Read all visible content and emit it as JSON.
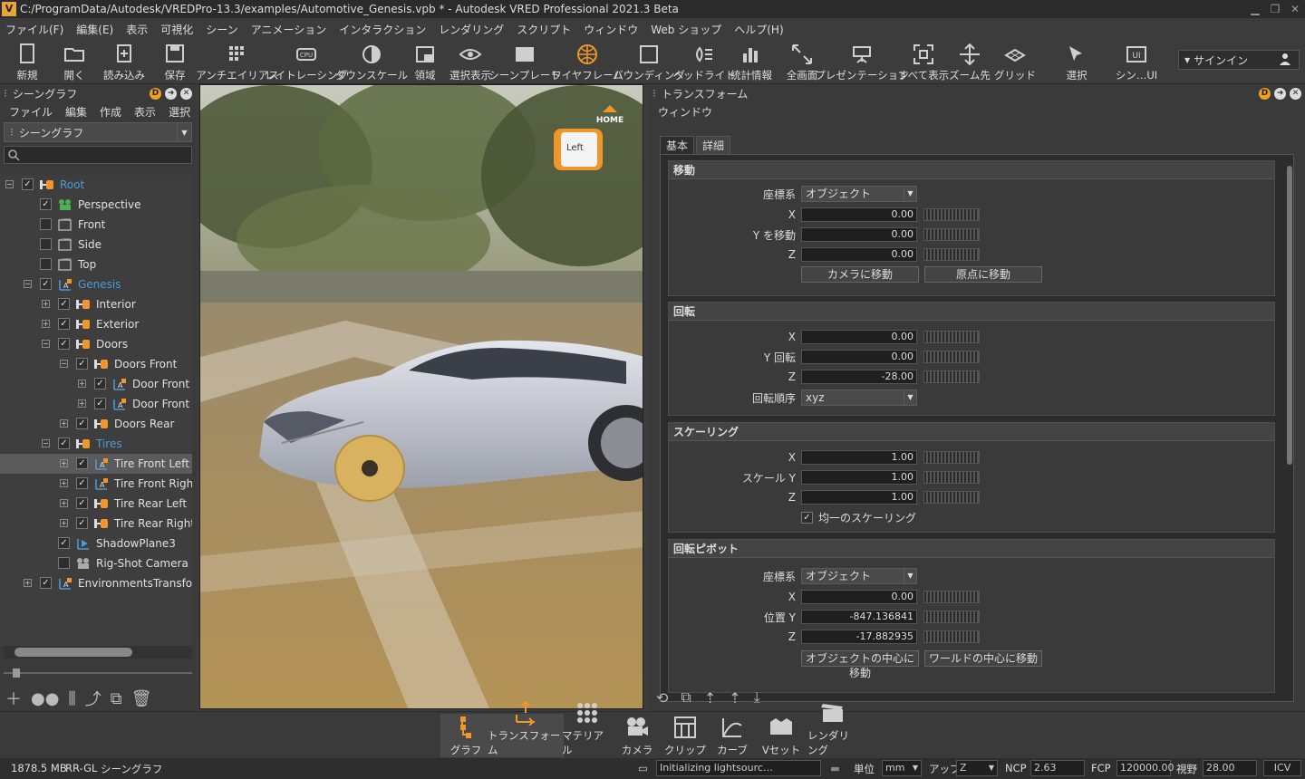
{
  "window": {
    "title": "C:/ProgramData/Autodesk/VREDPro-13.3/examples/Automotive_Genesis.vpb * - Autodesk VRED Professional 2021.3 Beta"
  },
  "menu": [
    "ファイル(F)",
    "編集(E)",
    "表示",
    "可視化",
    "シーン",
    "アニメーション",
    "インタラクション",
    "レンダリング",
    "スクリプト",
    "ウィンドウ",
    "Web ショップ",
    "ヘルプ(H)"
  ],
  "toolbar": [
    {
      "label": "新規",
      "icon": "new-file-icon"
    },
    {
      "label": "開く",
      "icon": "open-folder-icon"
    },
    {
      "label": "読み込み",
      "icon": "import-icon"
    },
    {
      "label": "保存",
      "icon": "save-icon"
    },
    {
      "label": "アンチエイリアス",
      "icon": "antialias-icon"
    },
    {
      "label": "レイトレーシング",
      "icon": "cpu-icon"
    },
    {
      "label": "ダウンスケール",
      "icon": "downscale-icon"
    },
    {
      "label": "領域",
      "icon": "region-icon"
    },
    {
      "label": "選択表示",
      "icon": "eye-icon"
    },
    {
      "label": "シーンプレート",
      "icon": "sceneplate-icon"
    },
    {
      "label": "ワイヤフレーム",
      "icon": "wireframe-globe-icon"
    },
    {
      "label": "バウンディング",
      "icon": "bounding-box-icon"
    },
    {
      "label": "ヘッドライト",
      "icon": "headlight-icon"
    },
    {
      "label": "統計情報",
      "icon": "statistics-icon"
    },
    {
      "label": "全画面",
      "icon": "fullscreen-icon"
    },
    {
      "label": "プレゼンテーション",
      "icon": "presentation-icon"
    },
    {
      "label": "すべて表示",
      "icon": "fit-all-icon"
    },
    {
      "label": "ズーム先",
      "icon": "zoom-to-icon"
    },
    {
      "label": "グリッド",
      "icon": "grid-icon"
    },
    {
      "label": "選択",
      "icon": "select-icon"
    },
    {
      "label": "シン…UI",
      "icon": "ui-icon"
    }
  ],
  "signin": {
    "label": "サインイン"
  },
  "scenegraph": {
    "title": "シーングラフ",
    "menu": [
      "ファイル",
      "編集",
      "作成",
      "表示",
      "選択"
    ],
    "combo": "シーングラフ",
    "search_placeholder": "",
    "nodes": [
      {
        "label": "Root",
        "depth": 0,
        "expander": "-",
        "checked": true,
        "icon": "transform-icon",
        "color": "#4a9bd8",
        "selected": false
      },
      {
        "label": "Perspective",
        "depth": 1,
        "expander": "",
        "checked": true,
        "icon": "perspective-camera-icon",
        "color": "#e0e0e0",
        "selected": false
      },
      {
        "label": "Front",
        "depth": 1,
        "expander": "",
        "checked": false,
        "icon": "ortho-camera-icon",
        "color": "#e0e0e0",
        "selected": false
      },
      {
        "label": "Side",
        "depth": 1,
        "expander": "",
        "checked": false,
        "icon": "ortho-camera-icon",
        "color": "#e0e0e0",
        "selected": false
      },
      {
        "label": "Top",
        "depth": 1,
        "expander": "",
        "checked": false,
        "icon": "ortho-camera-icon",
        "color": "#e0e0e0",
        "selected": false
      },
      {
        "label": "Genesis",
        "depth": 1,
        "expander": "-",
        "checked": true,
        "icon": "transform-axis-icon",
        "color": "#4a9bd8",
        "selected": false
      },
      {
        "label": "Interior",
        "depth": 2,
        "expander": "+",
        "checked": true,
        "icon": "group-icon",
        "color": "#e0e0e0",
        "selected": false
      },
      {
        "label": "Exterior",
        "depth": 2,
        "expander": "+",
        "checked": true,
        "icon": "group-icon",
        "color": "#e0e0e0",
        "selected": false
      },
      {
        "label": "Doors",
        "depth": 2,
        "expander": "-",
        "checked": true,
        "icon": "group-icon",
        "color": "#e0e0e0",
        "selected": false
      },
      {
        "label": "Doors Front",
        "depth": 3,
        "expander": "-",
        "checked": true,
        "icon": "group-icon",
        "color": "#e0e0e0",
        "selected": false
      },
      {
        "label": "Door Front L",
        "depth": 4,
        "expander": "+",
        "checked": true,
        "icon": "transform-axis-icon",
        "color": "#e0e0e0",
        "selected": false
      },
      {
        "label": "Door Front R",
        "depth": 4,
        "expander": "+",
        "checked": true,
        "icon": "transform-axis-icon",
        "color": "#e0e0e0",
        "selected": false
      },
      {
        "label": "Doors Rear",
        "depth": 3,
        "expander": "+",
        "checked": true,
        "icon": "group-icon",
        "color": "#e0e0e0",
        "selected": false
      },
      {
        "label": "Tires",
        "depth": 2,
        "expander": "-",
        "checked": true,
        "icon": "group-icon",
        "color": "#4a9bd8",
        "selected": false
      },
      {
        "label": "Tire Front Left",
        "depth": 3,
        "expander": "+",
        "checked": true,
        "icon": "transform-axis-icon",
        "color": "#e0e0e0",
        "selected": true
      },
      {
        "label": "Tire Front Right",
        "depth": 3,
        "expander": "+",
        "checked": true,
        "icon": "transform-axis-icon",
        "color": "#e0e0e0",
        "selected": false
      },
      {
        "label": "Tire Rear Left",
        "depth": 3,
        "expander": "+",
        "checked": true,
        "icon": "group-icon",
        "color": "#e0e0e0",
        "selected": false
      },
      {
        "label": "Tire Rear Right",
        "depth": 3,
        "expander": "+",
        "checked": true,
        "icon": "group-icon",
        "color": "#e0e0e0",
        "selected": false
      },
      {
        "label": "ShadowPlane3",
        "depth": 2,
        "expander": "",
        "checked": true,
        "icon": "shadow-plane-icon",
        "color": "#e0e0e0",
        "selected": false
      },
      {
        "label": "Rig-Shot Camera",
        "depth": 2,
        "expander": "",
        "checked": false,
        "icon": "camera-rig-icon",
        "color": "#e0e0e0",
        "selected": false
      },
      {
        "label": "EnvironmentsTransform",
        "depth": 1,
        "expander": "+",
        "checked": true,
        "icon": "transform-axis-icon",
        "color": "#e0e0e0",
        "selected": false
      }
    ]
  },
  "viewport": {
    "cube_label": "Left",
    "home_label": "HOME"
  },
  "transform": {
    "title": "トランスフォーム",
    "menu": "ウィンドウ",
    "tabs": [
      "基本",
      "詳細"
    ],
    "move": {
      "title": "移動",
      "coord_label": "座標系",
      "coord_value": "オブジェクト",
      "axis_label": "Y を移動",
      "x": "0.00",
      "y": "0.00",
      "z": "0.00",
      "btn_camera": "カメラに移動",
      "btn_origin": "原点に移動"
    },
    "rotate": {
      "title": "回転",
      "axis_label": "Y 回転",
      "x": "0.00",
      "y": "0.00",
      "z": "-28.00",
      "order_label": "回転順序",
      "order_value": "xyz"
    },
    "scale": {
      "title": "スケーリング",
      "axis_label": "スケール Y",
      "x": "1.00",
      "y": "1.00",
      "z": "1.00",
      "uniform_label": "均一のスケーリング",
      "uniform": true
    },
    "pivot": {
      "title": "回転ピボット",
      "coord_label": "座標系",
      "coord_value": "オブジェクト",
      "axis_label": "位置 Y",
      "x": "0.00",
      "y": "-847.136841",
      "z": "-17.882935",
      "btn_object": "オブジェクトの中心に移動",
      "btn_world": "ワールドの中心に移動"
    }
  },
  "dock": [
    {
      "label": "グラフ",
      "icon": "graph-icon",
      "active": true
    },
    {
      "label": "トランスフォーム",
      "icon": "transform-move-icon",
      "active": true
    },
    {
      "label": "マテリアル",
      "icon": "material-icon",
      "active": false
    },
    {
      "label": "カメラ",
      "icon": "camera-icon",
      "active": false
    },
    {
      "label": "クリップ",
      "icon": "clip-icon",
      "active": false
    },
    {
      "label": "カーブ",
      "icon": "curve-icon",
      "active": false
    },
    {
      "label": "Vセット",
      "icon": "vset-icon",
      "active": false
    },
    {
      "label": "レンダリング",
      "icon": "render-icon",
      "active": false
    }
  ],
  "status": {
    "memory": "1878.5 MB",
    "renderer": "RR-GL",
    "module": "シーングラフ",
    "message": "Initializing lightsourc…",
    "unit_label": "単位",
    "unit_value": "mm",
    "up_label": "アップ",
    "up_value": "Z",
    "ncp_label": "NCP",
    "ncp_value": "2.63",
    "fcp_label": "FCP",
    "fcp_value": "120000.00",
    "fov_label": "視野",
    "fov_value": "28.00",
    "icv_label": "ICV"
  },
  "colors": {
    "accent": "#f0962a",
    "bg": "#3c3c3c",
    "selection": "#4a9bd8"
  }
}
